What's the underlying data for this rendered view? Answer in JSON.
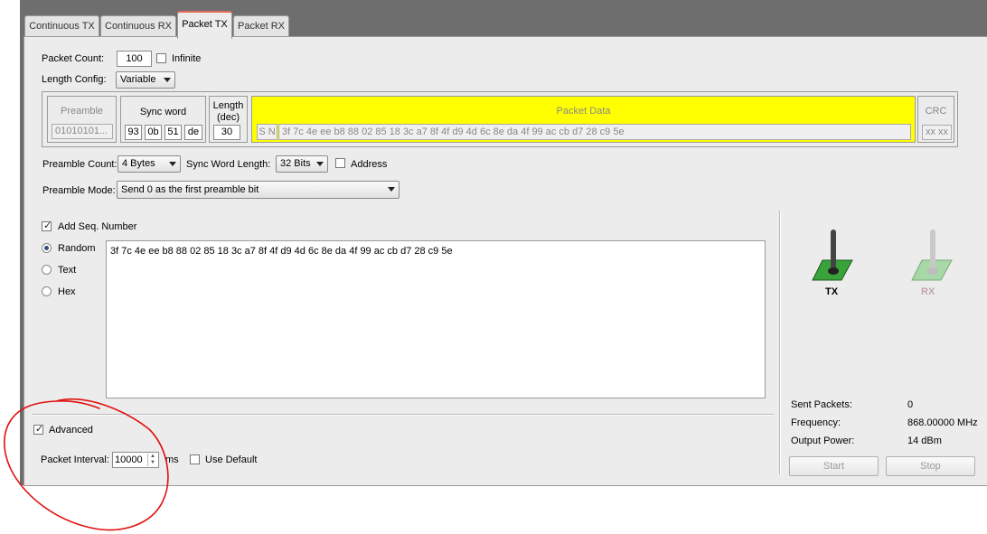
{
  "tabs": [
    {
      "label": "Continuous TX"
    },
    {
      "label": "Continuous RX"
    },
    {
      "label": "Packet TX"
    },
    {
      "label": "Packet RX"
    }
  ],
  "packet_count": {
    "label": "Packet Count:",
    "value": "100",
    "infinite_label": "Infinite"
  },
  "length_config": {
    "label": "Length Config:",
    "value": "Variable"
  },
  "frame": {
    "preamble": {
      "title": "Preamble",
      "value": "01010101..."
    },
    "sync_word": {
      "title": "Sync word",
      "bytes": [
        "93",
        "0b",
        "51",
        "de"
      ]
    },
    "length": {
      "title_line1": "Length",
      "title_line2": "(dec)",
      "value": "30"
    },
    "packet_data": {
      "title": "Packet Data",
      "prefix": "S N",
      "value": "3f 7c 4e ee b8 88 02 85 18 3c a7 8f 4f d9 4d 6c 8e da 4f 99 ac cb d7 28 c9 5e"
    },
    "crc": {
      "title": "CRC",
      "value": "xx xx"
    }
  },
  "preamble_count": {
    "label": "Preamble Count:",
    "value": "4 Bytes"
  },
  "sync_word_length": {
    "label": "Sync Word Length:",
    "value": "32 Bits"
  },
  "address": {
    "label": "Address"
  },
  "preamble_mode": {
    "label": "Preamble Mode:",
    "value": "Send 0 as the first preamble bit"
  },
  "add_seq": {
    "label": "Add Seq. Number"
  },
  "data_mode": {
    "random": "Random",
    "text": "Text",
    "hex": "Hex",
    "selected": "Random"
  },
  "data_text": "3f 7c 4e ee b8 88 02 85 18 3c a7 8f 4f d9 4d 6c 8e da 4f 99 ac cb d7 28 c9 5e",
  "advanced": {
    "label": "Advanced"
  },
  "packet_interval": {
    "label": "Packet Interval:",
    "value": "10000",
    "unit": "ms",
    "use_default": "Use Default"
  },
  "switches": {
    "tx_label": "TX",
    "rx_label": "RX"
  },
  "stats": {
    "sent_label": "Sent Packets:",
    "sent_value": "0",
    "freq_label": "Frequency:",
    "freq_value": "868.00000 MHz",
    "power_label": "Output Power:",
    "power_value": "14 dBm"
  },
  "buttons": {
    "start": "Start",
    "stop": "Stop"
  },
  "colors": {
    "packet_data_bg": "#ffff00",
    "annotation": "#e01010",
    "tx_switch": "#3aa23a",
    "rx_switch": "#a8d8a8"
  }
}
